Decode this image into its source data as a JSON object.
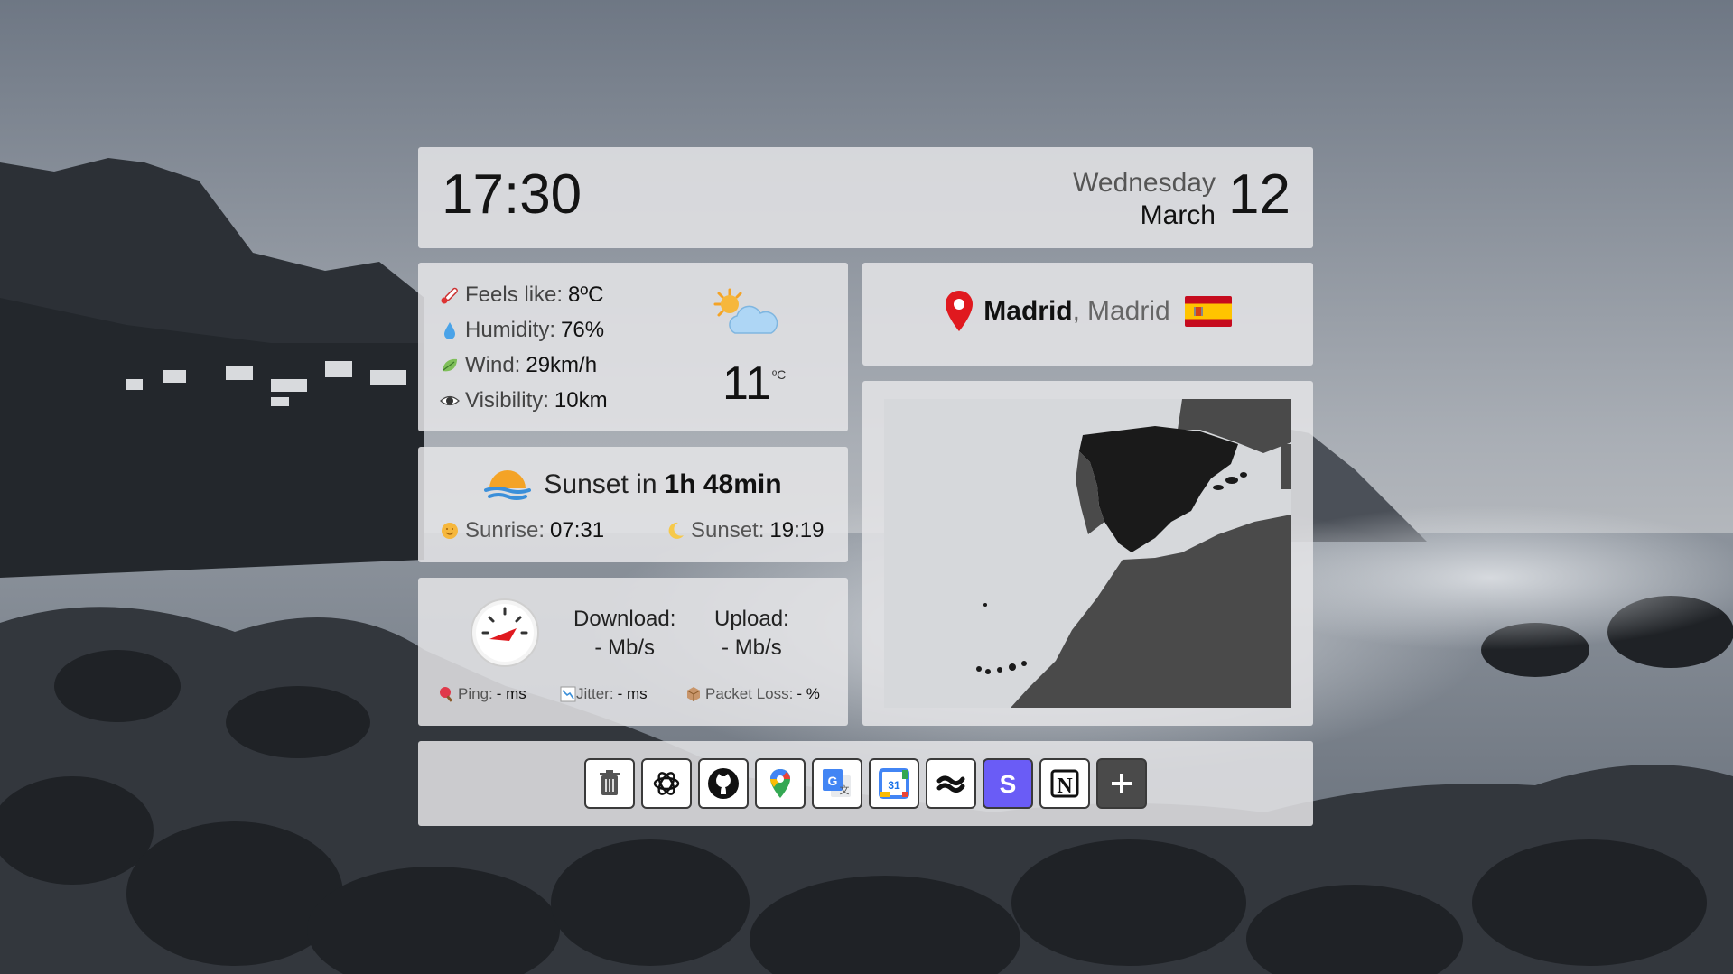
{
  "clock": {
    "time": "17:30"
  },
  "date": {
    "weekday": "Wednesday",
    "month": "March",
    "day": "12"
  },
  "weather": {
    "feels_like": {
      "label": "Feels like:",
      "value": "8ºC",
      "icon": "thermometer-icon"
    },
    "humidity": {
      "label": "Humidity:",
      "value": "76%",
      "icon": "droplet-icon"
    },
    "wind": {
      "label": "Wind:",
      "value": "29km/h",
      "icon": "leaf-icon"
    },
    "visibility": {
      "label": "Visibility:",
      "value": "10km",
      "icon": "eye-icon"
    },
    "temperature": "11",
    "unit": "ºC",
    "condition_icon": "partly-cloudy-icon"
  },
  "location": {
    "city": "Madrid",
    "separator": ",",
    "region": "Madrid",
    "flag": "spain-flag",
    "pin_color": "#e0191f"
  },
  "sun": {
    "countdown_label": "Sunset in",
    "countdown_value": "1h 48min",
    "sunrise": {
      "label": "Sunrise:",
      "value": "07:31"
    },
    "sunset": {
      "label": "Sunset:",
      "value": "19:19"
    }
  },
  "network": {
    "download": {
      "label": "Download:",
      "value": "- Mb/s"
    },
    "upload": {
      "label": "Upload:",
      "value": "- Mb/s"
    },
    "ping": {
      "label": "Ping:",
      "value": "- ms"
    },
    "jitter": {
      "label": "Jitter:",
      "value": "- ms"
    },
    "packet_loss": {
      "label": "Packet Loss:",
      "value": "- %"
    }
  },
  "shortcuts": [
    {
      "name": "trash",
      "icon": "trash-icon"
    },
    {
      "name": "chatgpt",
      "icon": "openai-icon"
    },
    {
      "name": "github",
      "icon": "github-icon"
    },
    {
      "name": "google-maps",
      "icon": "maps-pin-icon"
    },
    {
      "name": "google-translate",
      "icon": "translate-icon"
    },
    {
      "name": "google-calendar",
      "icon": "calendar-icon",
      "text": "31"
    },
    {
      "name": "app-wave",
      "icon": "wave-icon"
    },
    {
      "name": "app-s",
      "icon": "s-icon",
      "text": "S"
    },
    {
      "name": "notion",
      "icon": "notion-icon",
      "text": "N"
    },
    {
      "name": "add-shortcut",
      "icon": "plus-icon"
    }
  ],
  "colors": {
    "panel": "#e4e4e6",
    "map_land": "#4a4a4a",
    "map_spain": "#1a1a1a",
    "sun_orange": "#f4a326"
  }
}
